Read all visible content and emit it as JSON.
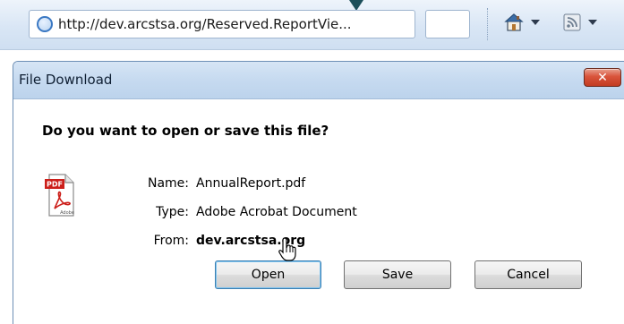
{
  "browser": {
    "address": "http://dev.arcstsa.org/Reserved.ReportVie...",
    "icons": {
      "page": "ie-page-icon",
      "home": "home-icon",
      "feeds": "rss-feed-icon"
    }
  },
  "dialog": {
    "title": "File Download",
    "close_label": "✕",
    "question": "Do you want to open or save this file?",
    "file_icon": "pdf-file-icon",
    "file_icon_badge": "PDF",
    "file_icon_brand": "Adobe",
    "fields": {
      "name_label": "Name:",
      "name_value": "AnnualReport.pdf",
      "type_label": "Type:",
      "type_value": "Adobe Acrobat Document",
      "from_label": "From:",
      "from_value": "dev.arcstsa.org"
    },
    "buttons": {
      "open": "Open",
      "save": "Save",
      "cancel": "Cancel"
    }
  },
  "colors": {
    "titlebar": "#c6daf0",
    "close_button": "#d9543b",
    "default_button_border": "#3c7fb1"
  }
}
